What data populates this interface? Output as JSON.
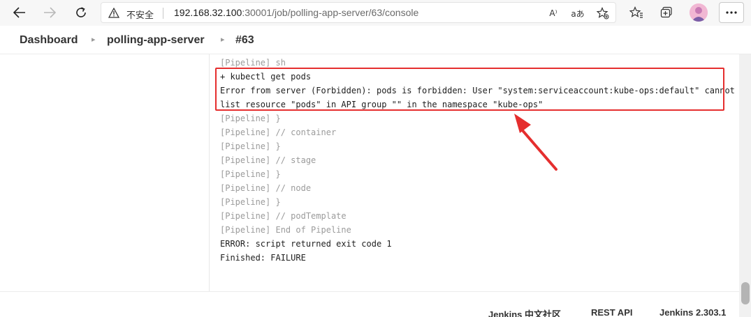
{
  "browser": {
    "security_label": "不安全",
    "url_host": "192.168.32.100",
    "url_path": ":30001/job/polling-app-server/63/console",
    "read_aloud_label": "A⁾",
    "translate_label": "aあ",
    "icons": [
      "back-icon",
      "forward-icon",
      "refresh-icon",
      "warning-icon",
      "star-add-icon",
      "favorites-icon",
      "collections-icon",
      "profile-icon",
      "more-icon"
    ]
  },
  "breadcrumb": {
    "items": [
      "Dashboard",
      "polling-app-server",
      "#63"
    ]
  },
  "console": {
    "lines": [
      {
        "text": "[Pipeline] sh",
        "style": "dim"
      },
      {
        "text": "+ kubectl get pods",
        "style": "hl"
      },
      {
        "text": "Error from server (Forbidden): pods is forbidden: User \"system:serviceaccount:kube-ops:default\" cannot",
        "style": "hl"
      },
      {
        "text": "list resource \"pods\" in API group \"\" in the namespace \"kube-ops\"",
        "style": "hl"
      },
      {
        "text": "[Pipeline] }",
        "style": "dim"
      },
      {
        "text": "[Pipeline] // container",
        "style": "dim"
      },
      {
        "text": "[Pipeline] }",
        "style": "dim"
      },
      {
        "text": "[Pipeline] // stage",
        "style": "dim"
      },
      {
        "text": "[Pipeline] }",
        "style": "dim"
      },
      {
        "text": "[Pipeline] // node",
        "style": "dim"
      },
      {
        "text": "[Pipeline] }",
        "style": "dim"
      },
      {
        "text": "[Pipeline] // podTemplate",
        "style": "dim"
      },
      {
        "text": "[Pipeline] End of Pipeline",
        "style": "dim"
      },
      {
        "text": "ERROR: script returned exit code 1",
        "style": "plain"
      },
      {
        "text": "Finished: FAILURE",
        "style": "plain"
      }
    ]
  },
  "annotation": {
    "color": "#e52e2e"
  },
  "footer": {
    "community": "Jenkins 中文社区",
    "rest_api": "REST API",
    "version": "Jenkins 2.303.1"
  }
}
